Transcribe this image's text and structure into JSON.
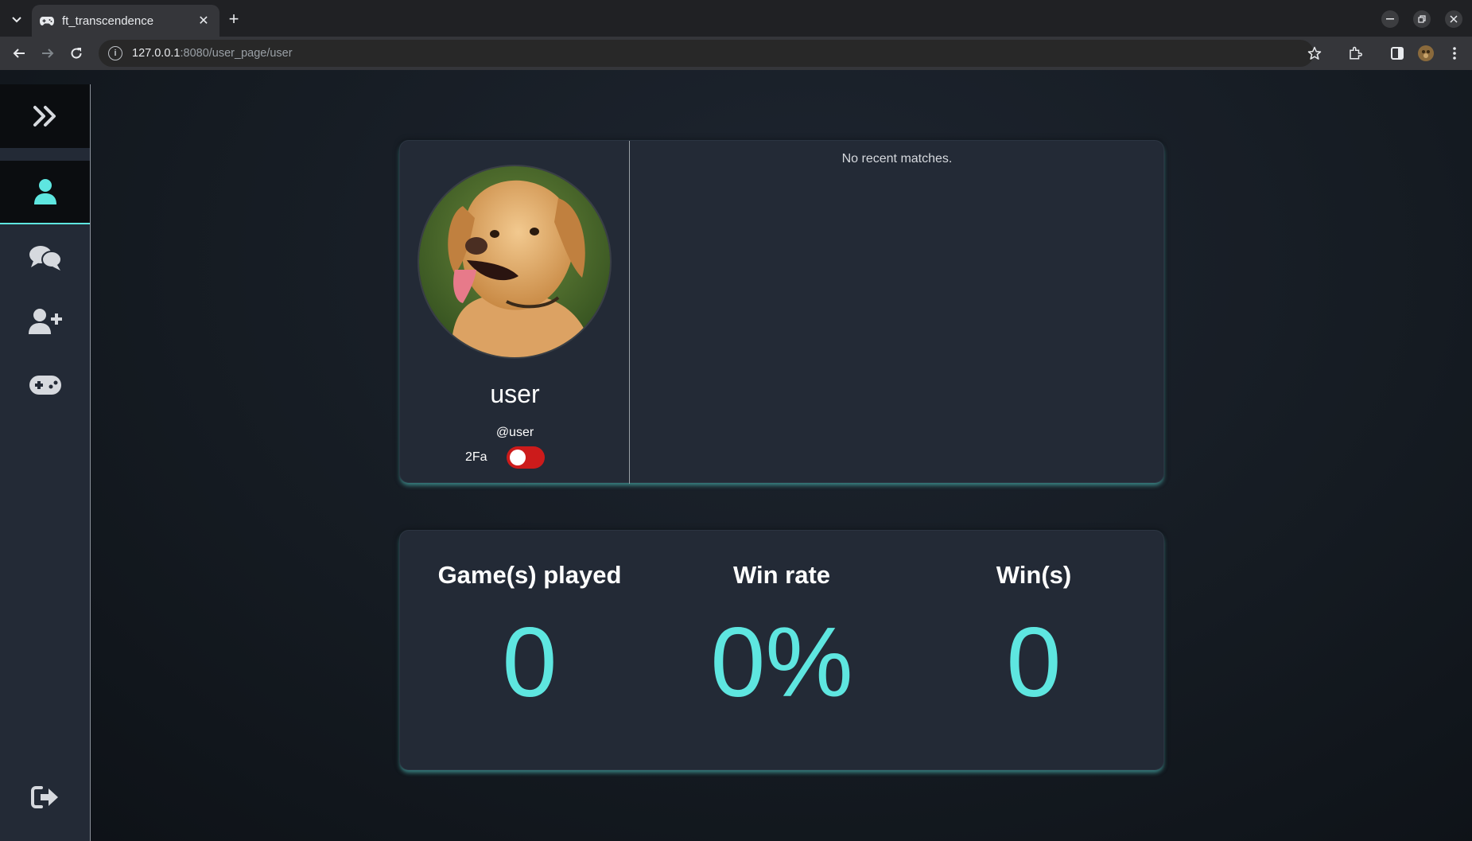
{
  "browser": {
    "tab_title": "ft_transcendence",
    "url_host": "127.0.0.1",
    "url_path": ":8080/user_page/user"
  },
  "colors": {
    "accent": "#5ee6e0",
    "toggle_off": "#cc1b1b",
    "card": "#232a36"
  },
  "sidebar": {
    "items": [
      {
        "icon": "double-chevron-right-icon"
      },
      {
        "icon": "user-icon",
        "active": true
      },
      {
        "icon": "chat-bubbles-icon"
      },
      {
        "icon": "add-user-icon"
      },
      {
        "icon": "gamepad-icon"
      },
      {
        "icon": "logout-icon"
      }
    ]
  },
  "profile": {
    "display_name": "user",
    "login": "@user",
    "twofa_label": "2Fa",
    "twofa_enabled": false,
    "matches_empty_text": "No recent matches."
  },
  "stats": {
    "games_played_label": "Game(s) played",
    "games_played_value": "0",
    "win_rate_label": "Win rate",
    "win_rate_value": "0%",
    "wins_label": "Win(s)",
    "wins_value": "0"
  }
}
